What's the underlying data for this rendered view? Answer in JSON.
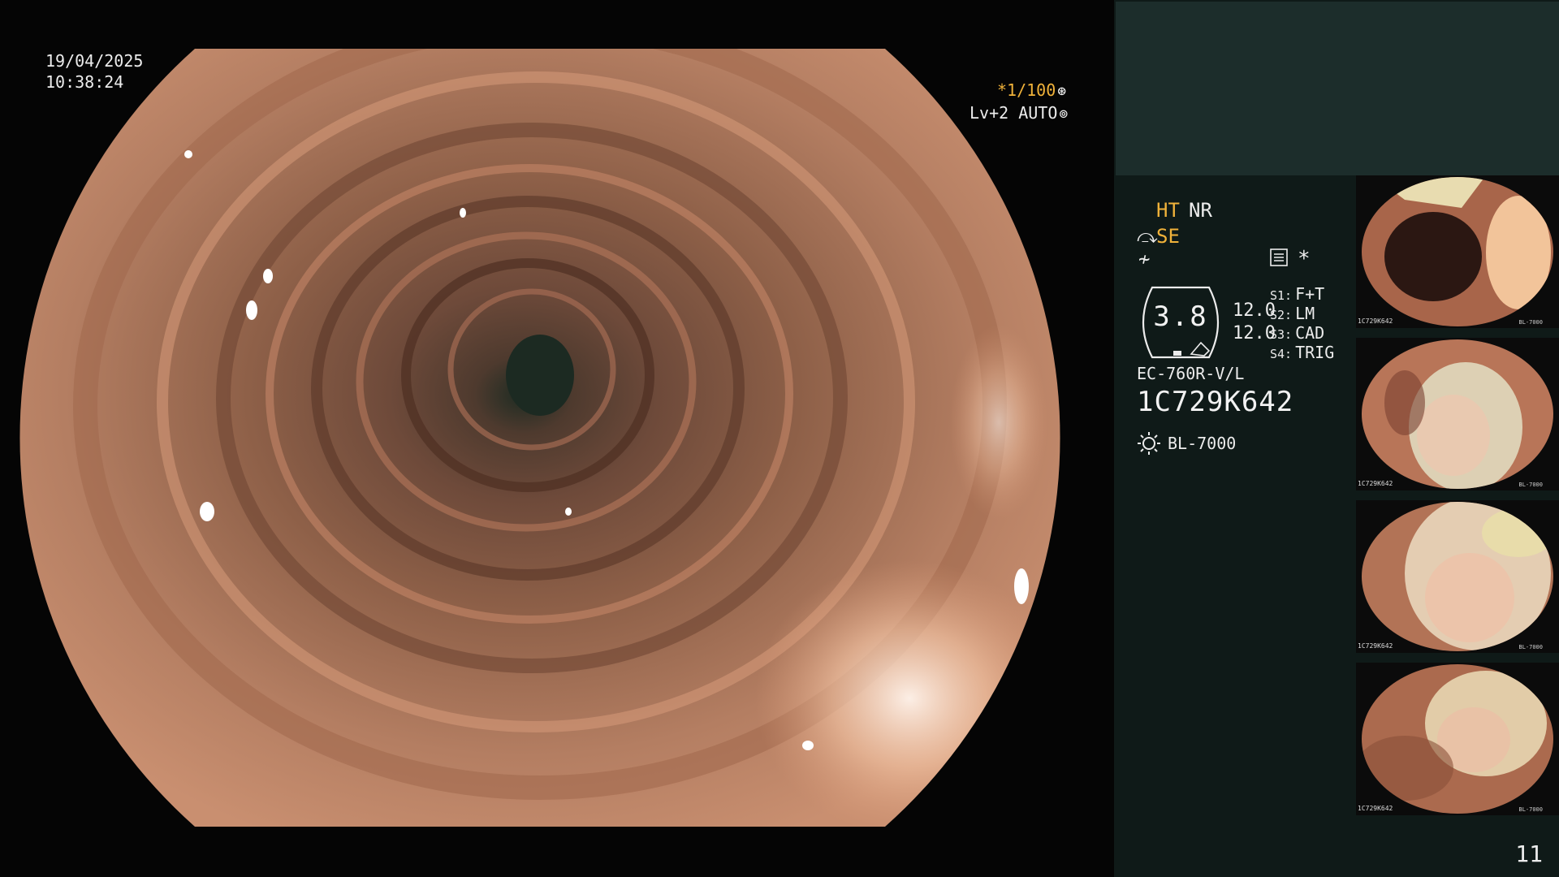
{
  "overlay": {
    "date": "19/04/2025",
    "time": "10:38:24",
    "shutter_prefix": "*",
    "shutter_value": "1/100",
    "iris_label": "Lv+2 AUTO"
  },
  "panel": {
    "mode_ht": "HT",
    "mode_nr": "NR",
    "mode_se": "SE",
    "gauge_value": "3.8",
    "gauge_side": [
      "12.0",
      "12.0"
    ],
    "scope_buttons": [
      {
        "key": "S1:",
        "value": "F+T"
      },
      {
        "key": "S2:",
        "value": "LM"
      },
      {
        "key": "S3:",
        "value": "CAD"
      },
      {
        "key": "S4:",
        "value": "TRIG"
      }
    ],
    "scope_model": "EC-760R-V/L",
    "scope_serial": "1C729K642",
    "light_source": "BL-7000",
    "page_number": "11"
  },
  "thumbnails": [
    {
      "serial": "1C729K642",
      "light": "BL-7000"
    },
    {
      "serial": "1C729K642",
      "light": "BL-7000"
    },
    {
      "serial": "1C729K642",
      "light": "BL-7000"
    },
    {
      "serial": "1C729K642",
      "light": "BL-7000"
    }
  ],
  "colors": {
    "accent": "#f0b23a",
    "panel_bg": "#0f1a18",
    "panel_band": "#1c2d2b",
    "mucosa": "#c98a6c"
  },
  "icons": {
    "shutter": "aperture-icon",
    "iris": "iris-icon",
    "se": "enhance-icon",
    "wave": "wave-icon",
    "settings": "settings-list-icon",
    "star": "asterisk-icon",
    "light": "sun-icon"
  }
}
